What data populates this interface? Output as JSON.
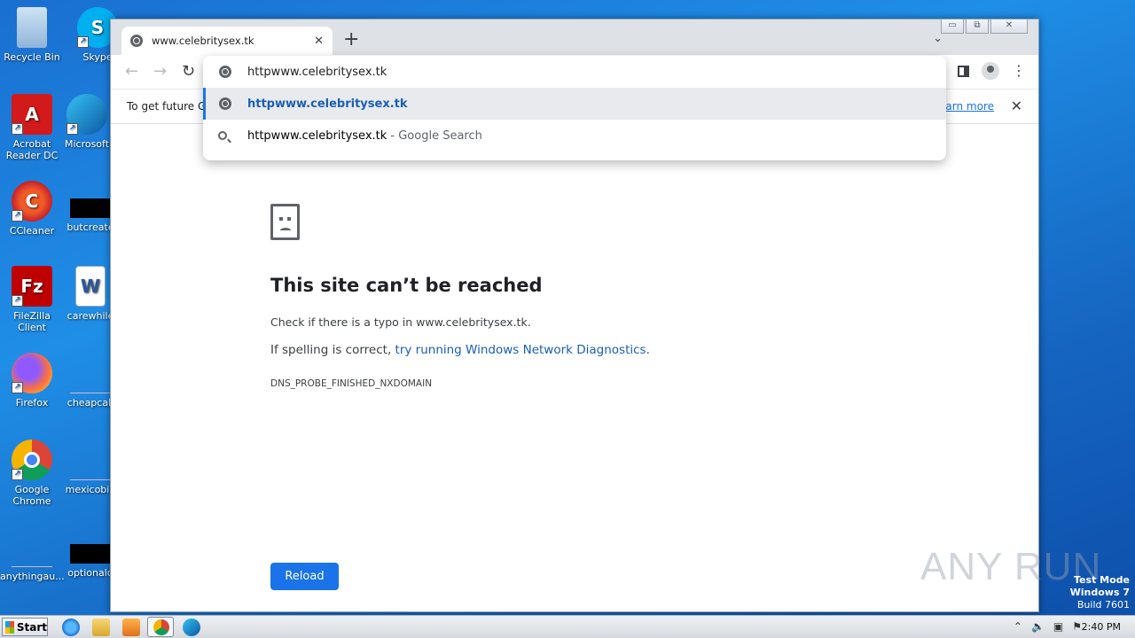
{
  "desktop": {
    "icons": [
      {
        "label": "Recycle Bin"
      },
      {
        "label": "Skype"
      },
      {
        "label": "Acrobat Reader DC"
      },
      {
        "label": "Microsoft"
      },
      {
        "label": "CCleaner"
      },
      {
        "label": "butcreate"
      },
      {
        "label": "FileZilla Client"
      },
      {
        "label": "carewhile"
      },
      {
        "label": "Firefox"
      },
      {
        "label": "cheapcall"
      },
      {
        "label": "Google Chrome"
      },
      {
        "label": "mexicobig"
      },
      {
        "label": "anythingau..."
      },
      {
        "label": "optionald"
      }
    ]
  },
  "browser": {
    "tab_title": "www.celebritysex.tk",
    "tab_close": "✕",
    "new_tab": "+",
    "tab_search": "⌄",
    "window_controls": {
      "minimize": "▭",
      "maximize": "⧉",
      "close": "✕"
    },
    "nav": {
      "back": "←",
      "forward": "→",
      "reload": "↻"
    },
    "menu_dots": "⋮",
    "infobar": {
      "message": "To get future G",
      "link": "earn more",
      "close": "✕"
    },
    "omnibox": {
      "input_value": "httpwww.celebritysex.tk",
      "suggestions": [
        {
          "text": "httpwww.celebritysex.tk",
          "suffix": ""
        },
        {
          "text": "httpwww.celebritysex.tk",
          "suffix": " - Google Search"
        }
      ]
    },
    "error_page": {
      "title": "This site can’t be reached",
      "check_text": "Check if there is a typo in www.celebritysex.tk.",
      "spelling_prefix": "If spelling is correct, ",
      "diagnostics_link": "try running Windows Network Diagnostics",
      "diagnostics_suffix": ".",
      "error_code": "DNS_PROBE_FINISHED_NXDOMAIN",
      "reload_label": "Reload"
    }
  },
  "watermark": "ANY RUN",
  "test_mode": {
    "line1": "Test Mode",
    "line2": "Windows 7",
    "line3": "Build 7601"
  },
  "taskbar": {
    "start_label": "Start",
    "clock": "2:40 PM"
  }
}
